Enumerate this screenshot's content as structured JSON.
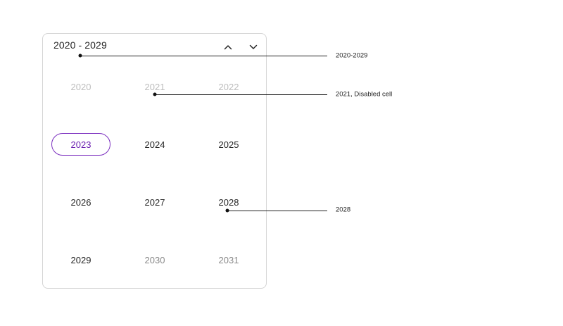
{
  "picker": {
    "range_title": "2020 - 2029",
    "prev_icon": "chevron-up-icon",
    "next_icon": "chevron-down-icon",
    "accent_color": "#7b2fbf",
    "years": [
      {
        "label": "2020",
        "state": "disabled"
      },
      {
        "label": "2021",
        "state": "disabled"
      },
      {
        "label": "2022",
        "state": "disabled"
      },
      {
        "label": "2023",
        "state": "selected"
      },
      {
        "label": "2024",
        "state": "normal"
      },
      {
        "label": "2025",
        "state": "normal"
      },
      {
        "label": "2026",
        "state": "normal"
      },
      {
        "label": "2027",
        "state": "normal"
      },
      {
        "label": "2028",
        "state": "normal"
      },
      {
        "label": "2029",
        "state": "normal"
      },
      {
        "label": "2030",
        "state": "outside"
      },
      {
        "label": "2031",
        "state": "outside"
      }
    ]
  },
  "annotations": [
    {
      "label": "2020-2029"
    },
    {
      "label": "2021, Disabled cell"
    },
    {
      "label": "2028"
    }
  ]
}
